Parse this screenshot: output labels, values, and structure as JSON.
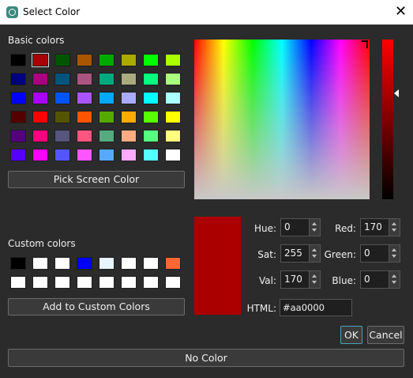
{
  "window": {
    "title": "Select Color",
    "close_glyph": "✕"
  },
  "basic": {
    "label": "Basic colors",
    "swatches": [
      "#000000",
      "#aa0000",
      "#005500",
      "#aa5500",
      "#00aa00",
      "#aaaa00",
      "#00ff00",
      "#aaff00",
      "#00007f",
      "#aa007f",
      "#00557f",
      "#aa557f",
      "#00aa7f",
      "#aaaa7f",
      "#00ff7f",
      "#aaff7f",
      "#0000ff",
      "#aa00ff",
      "#0055ff",
      "#aa55ff",
      "#00aaff",
      "#aaaaff",
      "#00ffff",
      "#aaffff",
      "#550000",
      "#ff0000",
      "#555500",
      "#ff5500",
      "#55aa00",
      "#ffaa00",
      "#55ff00",
      "#ffff00",
      "#55007f",
      "#ff007f",
      "#55557f",
      "#ff557f",
      "#55aa7f",
      "#ffaa7f",
      "#55ff7f",
      "#ffff7f",
      "#5500ff",
      "#ff00ff",
      "#5555ff",
      "#ff55ff",
      "#55aaff",
      "#ffaaff",
      "#55ffff",
      "#ffffff"
    ],
    "selected_index": 1
  },
  "pick_button": "Pick Screen Color",
  "custom": {
    "label": "Custom colors",
    "swatches": [
      "#000000",
      "#ffffff",
      "#ffffff",
      "#0000ff",
      "#e8f4ff",
      "#ffffff",
      "#ffffff",
      "#ff6633",
      "#ffffff",
      "#ffffff",
      "#ffffff",
      "#ffffff",
      "#ffffff",
      "#ffffff",
      "#ffffff",
      "#ffffff"
    ]
  },
  "add_button": "Add to Custom Colors",
  "current_color": "#aa0000",
  "fields": {
    "hue": {
      "label": "Hue:",
      "value": "0"
    },
    "sat": {
      "label": "Sat:",
      "value": "255"
    },
    "val": {
      "label": "Val:",
      "value": "170"
    },
    "red": {
      "label": "Red:",
      "value": "170"
    },
    "green": {
      "label": "Green:",
      "value": "0"
    },
    "blue": {
      "label": "Blue:",
      "value": "0"
    },
    "html": {
      "label": "HTML:",
      "value": "#aa0000"
    }
  },
  "buttons": {
    "ok": "OK",
    "cancel": "Cancel",
    "no_color": "No Color"
  }
}
